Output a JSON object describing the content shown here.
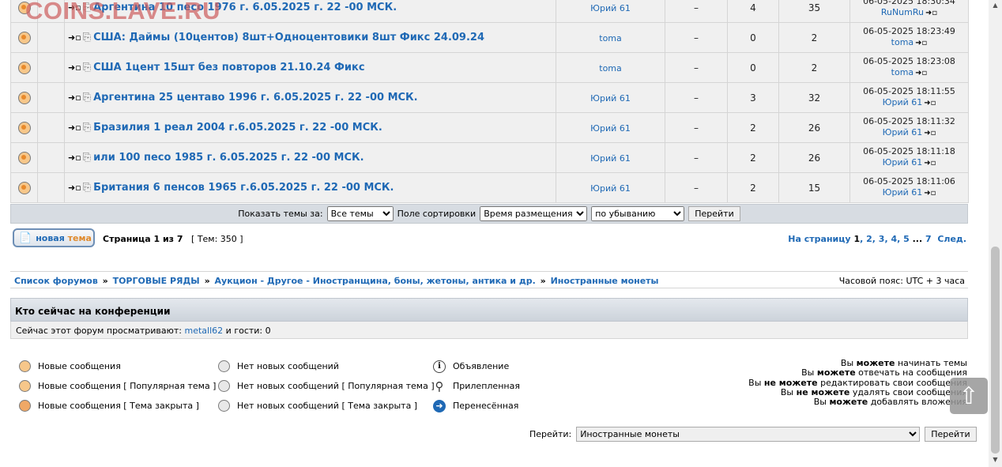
{
  "watermark": "COINS.LAVE.RU",
  "topics": [
    {
      "title": "Аргентина 10 песо 1976 г. 6.05.2025 г. 22 -00 МСК.",
      "author": "Юрий 61",
      "dash": "–",
      "replies": "4",
      "views": "35",
      "last_date": "06-05-2025 18:30:34",
      "last_author": "RuNumRu"
    },
    {
      "title": "США: Даймы (10центов) 8шт+Одноцентовики 8шт Фикс 24.09.24",
      "author": "toma",
      "dash": "–",
      "replies": "0",
      "views": "2",
      "last_date": "06-05-2025 18:23:49",
      "last_author": "toma"
    },
    {
      "title": "США 1цент 15шт без повторов 21.10.24 Фикс",
      "author": "toma",
      "dash": "–",
      "replies": "0",
      "views": "2",
      "last_date": "06-05-2025 18:23:08",
      "last_author": "toma"
    },
    {
      "title": "Аргентина 25 центаво 1996 г. 6.05.2025 г. 22 -00 МСК.",
      "author": "Юрий 61",
      "dash": "–",
      "replies": "3",
      "views": "32",
      "last_date": "06-05-2025 18:11:55",
      "last_author": "Юрий 61"
    },
    {
      "title": "Бразилия 1 реал 2004 г.6.05.2025 г. 22 -00 МСК.",
      "author": "Юрий 61",
      "dash": "–",
      "replies": "2",
      "views": "26",
      "last_date": "06-05-2025 18:11:32",
      "last_author": "Юрий 61"
    },
    {
      "title": "или 100 песо 1985 г. 6.05.2025 г. 22 -00 МСК.",
      "author": "Юрий 61",
      "dash": "–",
      "replies": "2",
      "views": "26",
      "last_date": "06-05-2025 18:11:18",
      "last_author": "Юрий 61"
    },
    {
      "title": "Британия 6 пенсов 1965 г.6.05.2025 г. 22 -00 МСК.",
      "author": "Юрий 61",
      "dash": "–",
      "replies": "2",
      "views": "15",
      "last_date": "06-05-2025 18:11:06",
      "last_author": "Юрий 61"
    }
  ],
  "sortbar": {
    "show_label": "Показать темы за:",
    "show_value": "Все темы",
    "sort_label": "Поле сортировки",
    "sort_value": "Время размещения",
    "order_value": "по убыванию",
    "go_label": "Перейти"
  },
  "new_topic": {
    "part1": "новая",
    "part2": "тема"
  },
  "page_info": {
    "text": "Страница 1 из 7",
    "topics": "[ Тем: 350 ]"
  },
  "pagination": {
    "label": "На страницу",
    "pages": [
      "1",
      "2",
      "3",
      "4",
      "5"
    ],
    "ellipsis": "...",
    "last": "7",
    "next": "След."
  },
  "breadcrumb": [
    "Список форумов",
    "ТОРГОВЫЕ РЯДЫ",
    "Аукцион - Другое - Иностранщина, боны, жетоны, антика и др.",
    "Иностранные монеты"
  ],
  "breadcrumb_sep": "»",
  "timezone": "Часовой пояс: UTC + 3 часа",
  "online": {
    "title": "Кто сейчас на конференции",
    "prefix": "Сейчас этот форум просматривают:",
    "user": "metall62",
    "suffix": "и гости: 0"
  },
  "legend": {
    "col1": [
      "Новые сообщения",
      "Новые сообщения [ Популярная тема ]",
      "Новые сообщения [ Тема закрыта ]"
    ],
    "col2": [
      "Нет новых сообщений",
      "Нет новых сообщений [ Популярная тема ]",
      "Нет новых сообщений [ Тема закрыта ]"
    ],
    "col3": [
      "Объявление",
      "Прилепленная",
      "Перенесённая"
    ]
  },
  "permissions": [
    {
      "pre": "Вы",
      "bold": "можете",
      "post": "начинать темы"
    },
    {
      "pre": "Вы",
      "bold": "можете",
      "post": "отвечать на сообщения"
    },
    {
      "pre": "Вы",
      "bold": "не можете",
      "post": "редактировать свои сообщения"
    },
    {
      "pre": "Вы",
      "bold": "не можете",
      "post": "удалять свои сообщения"
    },
    {
      "pre": "Вы",
      "bold": "можете",
      "post": "добавлять вложения"
    }
  ],
  "jump": {
    "label": "Перейти:",
    "value": "Иностранные монеты",
    "button": "Перейти"
  },
  "icons": {
    "topic": "folder-new-icon",
    "go": "go-to-newest-icon",
    "clip": "paperclip-icon",
    "last": "view-latest-icon"
  },
  "colors": {
    "link": "#1f69b5",
    "row_bg": "#f0f0f0",
    "header_bg": "#d7dce2",
    "watermark": "#cd5f5f"
  }
}
